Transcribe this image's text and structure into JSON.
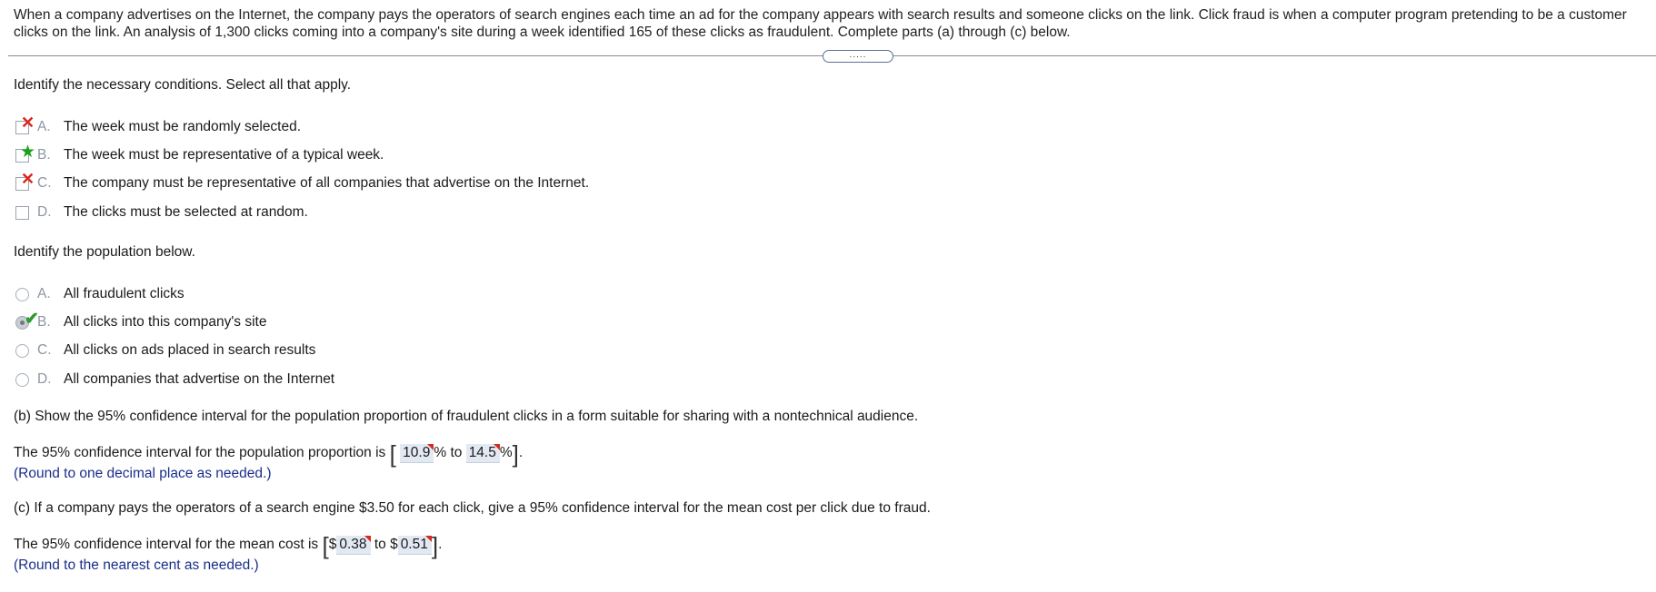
{
  "intro": "When a company advertises on the Internet, the company pays the operators of search engines each time an ad for the company appears with search results and someone clicks on the link. Click fraud is when a computer program pretending to be a customer clicks on the link. An analysis of 1,300 clicks coming into a company's site during a week identified 165 of these clicks as fraudulent. Complete parts (a) through (c) below.",
  "more_button": ".....",
  "q1": {
    "prompt": "Identify the necessary conditions. Select all that apply.",
    "options": [
      {
        "letter": "A.",
        "text": "The week must be randomly selected.",
        "mark": "incorrect"
      },
      {
        "letter": "B.",
        "text": "The week must be representative of a typical week.",
        "mark": "correct-star"
      },
      {
        "letter": "C.",
        "text": "The company must be representative of all companies that advertise on the Internet.",
        "mark": "incorrect"
      },
      {
        "letter": "D.",
        "text": "The clicks must be selected at random.",
        "mark": "none"
      }
    ]
  },
  "q2": {
    "prompt": "Identify the population below.",
    "options": [
      {
        "letter": "A.",
        "text": "All fraudulent clicks"
      },
      {
        "letter": "B.",
        "text": "All clicks into this company's site",
        "selected": true
      },
      {
        "letter": "C.",
        "text": "All clicks on ads placed in search results"
      },
      {
        "letter": "D.",
        "text": "All companies that advertise on the Internet"
      }
    ]
  },
  "partb": {
    "prompt": "(b) Show the 95% confidence interval for the population proportion of fraudulent clicks in a form suitable for sharing with a nontechnical audience.",
    "answer_prefix": "The 95% confidence interval for the population proportion is",
    "value1": "10.9",
    "unit1": "%",
    "to": "to",
    "value2": "14.5",
    "unit2": "%",
    "hint": "(Round to one decimal place as needed.)"
  },
  "partc": {
    "prompt": "(c) If a company pays the operators of a search engine $3.50 for each click, give a 95% confidence interval for the mean cost per click due to fraud.",
    "answer_prefix": "The 95% confidence interval for the mean cost is",
    "currency1": "$",
    "value1": "0.38",
    "to": "to",
    "currency2": "$",
    "value2": "0.51",
    "hint": "(Round to the nearest cent as needed.)"
  }
}
